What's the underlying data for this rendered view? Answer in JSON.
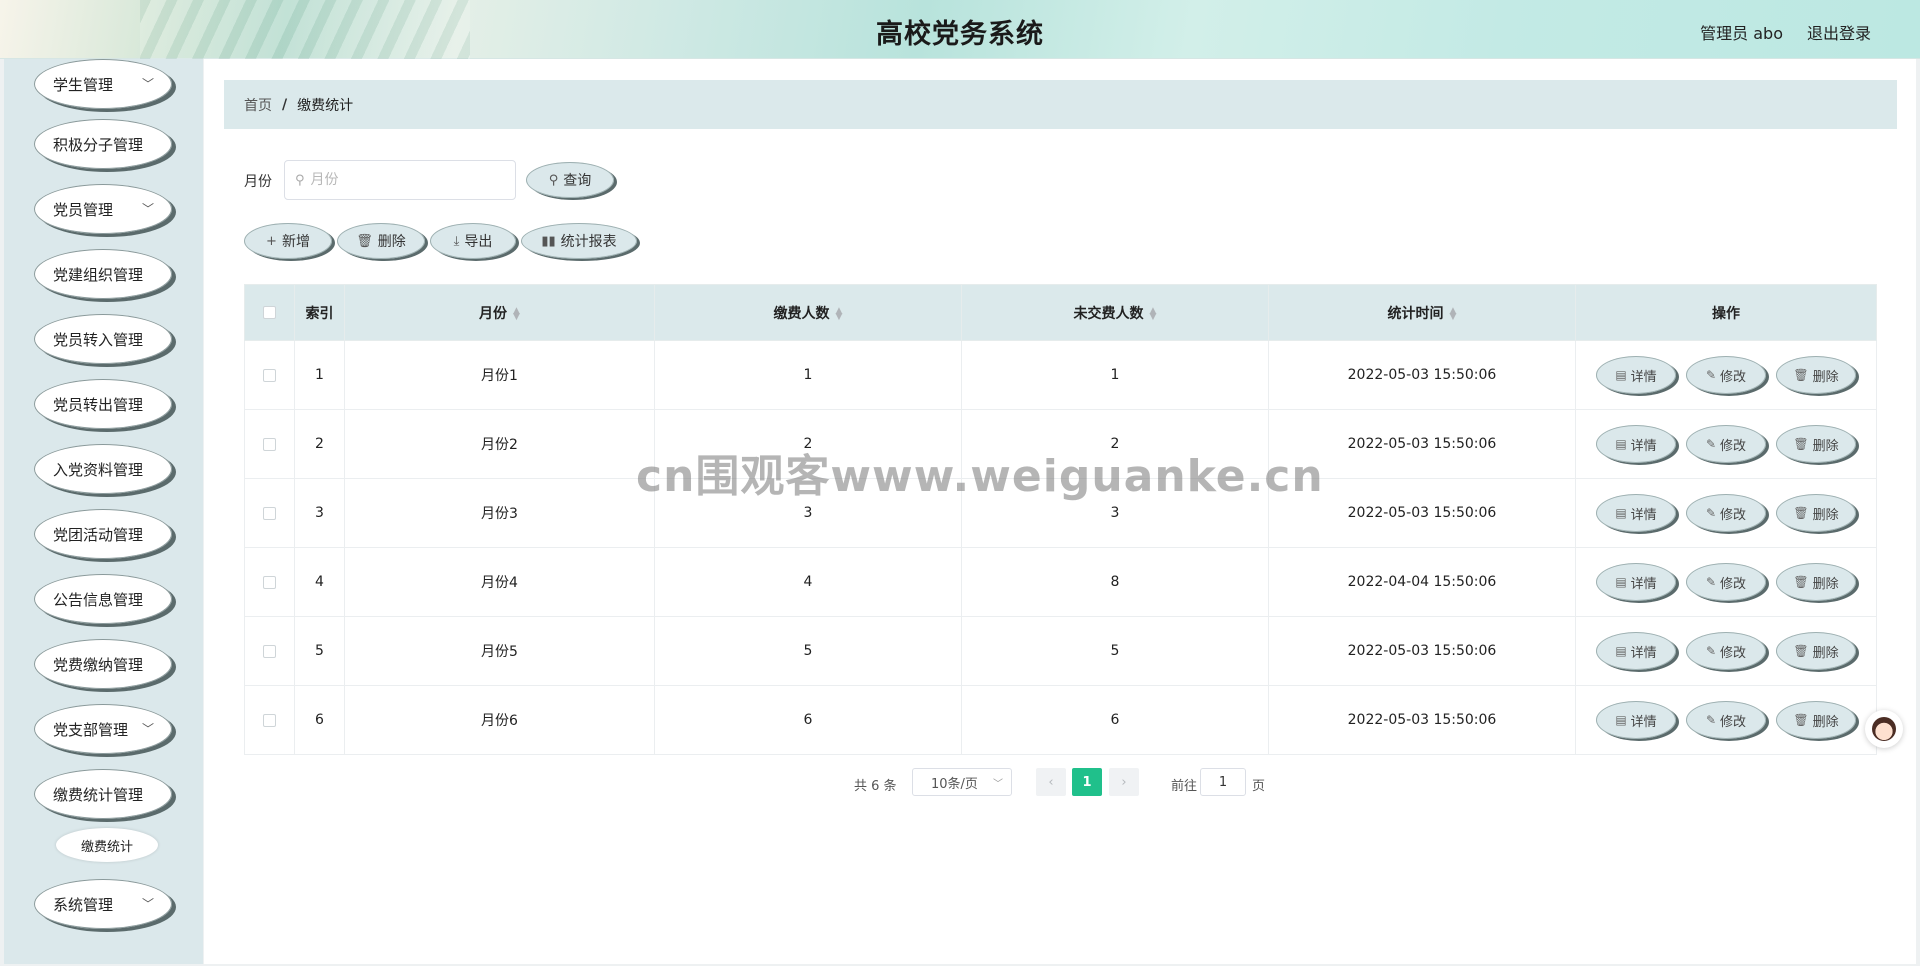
{
  "header": {
    "title": "高校党务系统",
    "user": "管理员 abo",
    "logout": "退出登录"
  },
  "sidebar": {
    "items": [
      {
        "label": "学生管理",
        "has_children": true
      },
      {
        "label": "积极分子管理",
        "has_children": false
      },
      {
        "label": "党员管理",
        "has_children": true
      },
      {
        "label": "党建组织管理",
        "has_children": false
      },
      {
        "label": "党员转入管理",
        "has_children": false
      },
      {
        "label": "党员转出管理",
        "has_children": false
      },
      {
        "label": "入党资料管理",
        "has_children": false
      },
      {
        "label": "党团活动管理",
        "has_children": false
      },
      {
        "label": "公告信息管理",
        "has_children": false
      },
      {
        "label": "党费缴纳管理",
        "has_children": false
      },
      {
        "label": "党支部管理",
        "has_children": true
      },
      {
        "label": "缴费统计管理",
        "has_children": false
      },
      {
        "label": "缴费统计",
        "submenu": true
      },
      {
        "label": "系统管理",
        "has_children": true
      }
    ]
  },
  "breadcrumb": {
    "home": "首页",
    "separator": "/",
    "current": "缴费统计"
  },
  "filter": {
    "label": "月份",
    "placeholder": "月份",
    "search_button": "查询"
  },
  "toolbar": {
    "add": "新增",
    "delete": "删除",
    "export": "导出",
    "report": "统计报表"
  },
  "table": {
    "headers": {
      "index": "索引",
      "month": "月份",
      "paid": "缴费人数",
      "unpaid": "未交费人数",
      "time": "统计时间",
      "actions": "操作"
    },
    "rows": [
      {
        "index": "1",
        "month": "月份1",
        "paid": "1",
        "unpaid": "1",
        "time": "2022-05-03 15:50:06"
      },
      {
        "index": "2",
        "month": "月份2",
        "paid": "2",
        "unpaid": "2",
        "time": "2022-05-03 15:50:06"
      },
      {
        "index": "3",
        "month": "月份3",
        "paid": "3",
        "unpaid": "3",
        "time": "2022-05-03 15:50:06"
      },
      {
        "index": "4",
        "month": "月份4",
        "paid": "4",
        "unpaid": "8",
        "time": "2022-04-04 15:50:06"
      },
      {
        "index": "5",
        "month": "月份5",
        "paid": "5",
        "unpaid": "5",
        "time": "2022-05-03 15:50:06"
      },
      {
        "index": "6",
        "month": "月份6",
        "paid": "6",
        "unpaid": "6",
        "time": "2022-05-03 15:50:06"
      }
    ],
    "row_actions": {
      "detail": "详情",
      "edit": "修改",
      "delete": "删除"
    }
  },
  "pagination": {
    "total": "共 6 条",
    "page_size": "10条/页",
    "current_page": "1",
    "goto_prefix": "前往",
    "goto_value": "1",
    "goto_suffix": "页"
  },
  "watermark": "cn围观客www.weiguanke.cn",
  "colors": {
    "accent": "#20c08b",
    "panel": "#dbe8eb",
    "pill_shadow": "#5b6b6c"
  }
}
